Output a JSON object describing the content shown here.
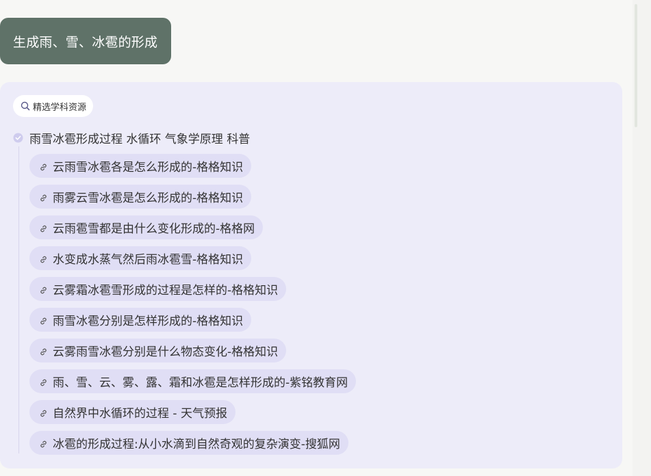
{
  "user_message": "生成雨、雪、冰雹的形成",
  "answer": {
    "source_badge": {
      "icon": "search-icon",
      "label": "精选学科资源"
    },
    "query": {
      "icon": "check-circle-icon",
      "text": "雨雪冰雹形成过程 水循环 气象学原理 科普"
    },
    "results": [
      {
        "icon": "link-icon",
        "title": "云雨雪冰雹各是怎么形成的-格格知识"
      },
      {
        "icon": "link-icon",
        "title": "雨雾云雪冰雹是怎么形成的-格格知识"
      },
      {
        "icon": "link-icon",
        "title": "云雨雹雪都是由什么变化形成的-格格网"
      },
      {
        "icon": "link-icon",
        "title": "水变成水蒸气然后雨冰雹雪-格格知识"
      },
      {
        "icon": "link-icon",
        "title": "云雾霜冰雹雪形成的过程是怎样的-格格知识"
      },
      {
        "icon": "link-icon",
        "title": "雨雪冰雹分别是怎样形成的-格格知识"
      },
      {
        "icon": "link-icon",
        "title": "云雾雨雪冰雹分别是什么物态变化-格格知识"
      },
      {
        "icon": "link-icon",
        "title": "雨、雪、云、雾、露、霜和冰雹是怎样形成的-紫铭教育网"
      },
      {
        "icon": "link-icon",
        "title": "自然界中水循环的过程 - 天气预报"
      },
      {
        "icon": "link-icon",
        "title": "冰雹的形成过程:从小水滴到自然奇观的复杂演变-搜狐网"
      }
    ]
  },
  "colors": {
    "page_bg": "#f7f7f5",
    "user_bubble_bg": "#5f7268",
    "card_bg": "#edecf9",
    "result_pill_bg": "#e0def5",
    "text": "#333333"
  }
}
